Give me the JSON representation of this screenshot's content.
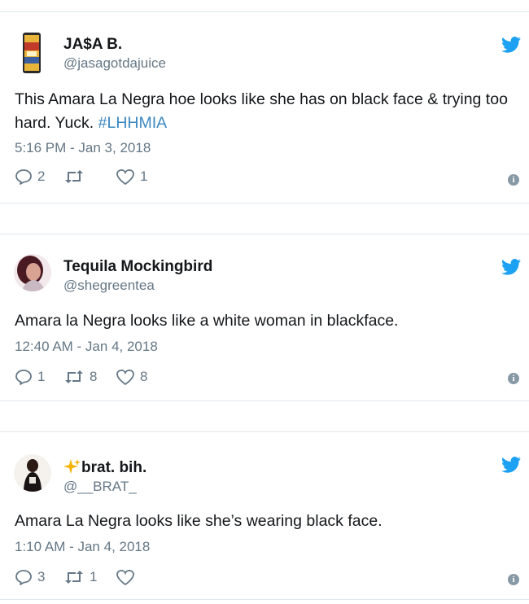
{
  "tweets": [
    {
      "name": "JA$A B.",
      "handle": "@jasagotdajuice",
      "text_before": "This Amara La Negra hoe looks like she has on black face & trying too hard. Yuck. ",
      "hashtag": "#LHHMIA",
      "time": "5:16 PM - Jan 3, 2018",
      "replies": "2",
      "retweets": "",
      "likes": "1",
      "info": "i"
    },
    {
      "name": "Tequila Mockingbird",
      "handle": "@shegreentea",
      "text_before": "Amara la Negra looks like a white woman in blackface.",
      "hashtag": "",
      "time": "12:40 AM - Jan 4, 2018",
      "replies": "1",
      "retweets": "8",
      "likes": "8",
      "info": "i"
    },
    {
      "name": "brat. bih.",
      "name_prefix_icon": "sparkles-emoji",
      "handle": "@__BRAT_",
      "text_before": "Amara La Negra looks like she’s wearing black face.",
      "hashtag": "",
      "time": "1:10 AM - Jan 4, 2018",
      "replies": "3",
      "retweets": "1",
      "likes": "",
      "info": "i"
    }
  ],
  "colors": {
    "twitter_blue": "#1da1f2",
    "text": "#14171a",
    "muted": "#657786",
    "hashtag": "#3b88c3"
  }
}
